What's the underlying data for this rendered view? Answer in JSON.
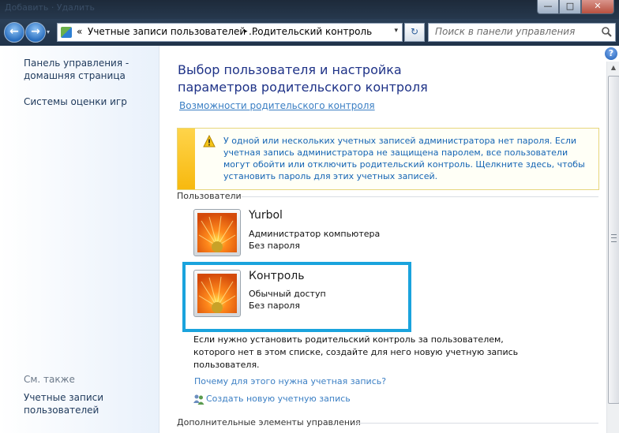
{
  "window": {
    "title": "Добавить · Удалить",
    "controls": {
      "minimize": "—",
      "maximize": "□",
      "close": "✕"
    }
  },
  "nav": {
    "back_glyph": "←",
    "forward_glyph": "→",
    "dropdown_glyph": "▾"
  },
  "address": {
    "chevron": "«",
    "crumb1": "Учетные записи пользователей ...",
    "separator": "▸",
    "crumb2": "Родительский контроль",
    "dropdown_glyph": "▾",
    "refresh_glyph": "↻"
  },
  "search": {
    "placeholder": "Поиск в панели управления"
  },
  "sidebar": {
    "home_line1": "Панель управления -",
    "home_line2": "домашняя страница",
    "ratings": "Системы оценки игр",
    "see_also": "См. также",
    "accounts_line1": "Учетные записи",
    "accounts_line2": "пользователей"
  },
  "main": {
    "help_glyph": "?",
    "title": "Выбор пользователя и настройка параметров родительского контроля",
    "features_link": "Возможности родительского контроля",
    "warning": "У одной или нескольких учетных записей администратора нет пароля. Если учетная запись администратора не защищена паролем, все пользователи могут обойти или отключить родительский контроль. Щелкните здесь, чтобы установить пароль для этих учетных записей.",
    "users_heading": "Пользователи",
    "users": [
      {
        "name": "Yurbol",
        "role": "Администратор компьютера",
        "password": "Без пароля"
      },
      {
        "name": "Контроль",
        "role": "Обычный доступ",
        "password": "Без пароля"
      }
    ],
    "note": "Если нужно установить родительский контроль за пользователем, которого нет в этом списке, создайте для него новую учетную запись пользователя.",
    "why_link": "Почему для этого нужна учетная запись?",
    "create_link": "Создать новую учетную запись",
    "more_heading": "Дополнительные элементы управления"
  },
  "colors": {
    "selection_border": "#1aa3dd",
    "link": "#3b7fc4",
    "title": "#1e3287",
    "warning_strip": "#f7b90f"
  },
  "icons": {
    "back": "back-arrow-icon",
    "forward": "forward-arrow-icon",
    "refresh": "refresh-icon",
    "search": "search-icon",
    "help": "help-icon",
    "warning": "warning-triangle-icon",
    "avatar": "flower-avatar-icon",
    "create_account": "users-icon"
  }
}
